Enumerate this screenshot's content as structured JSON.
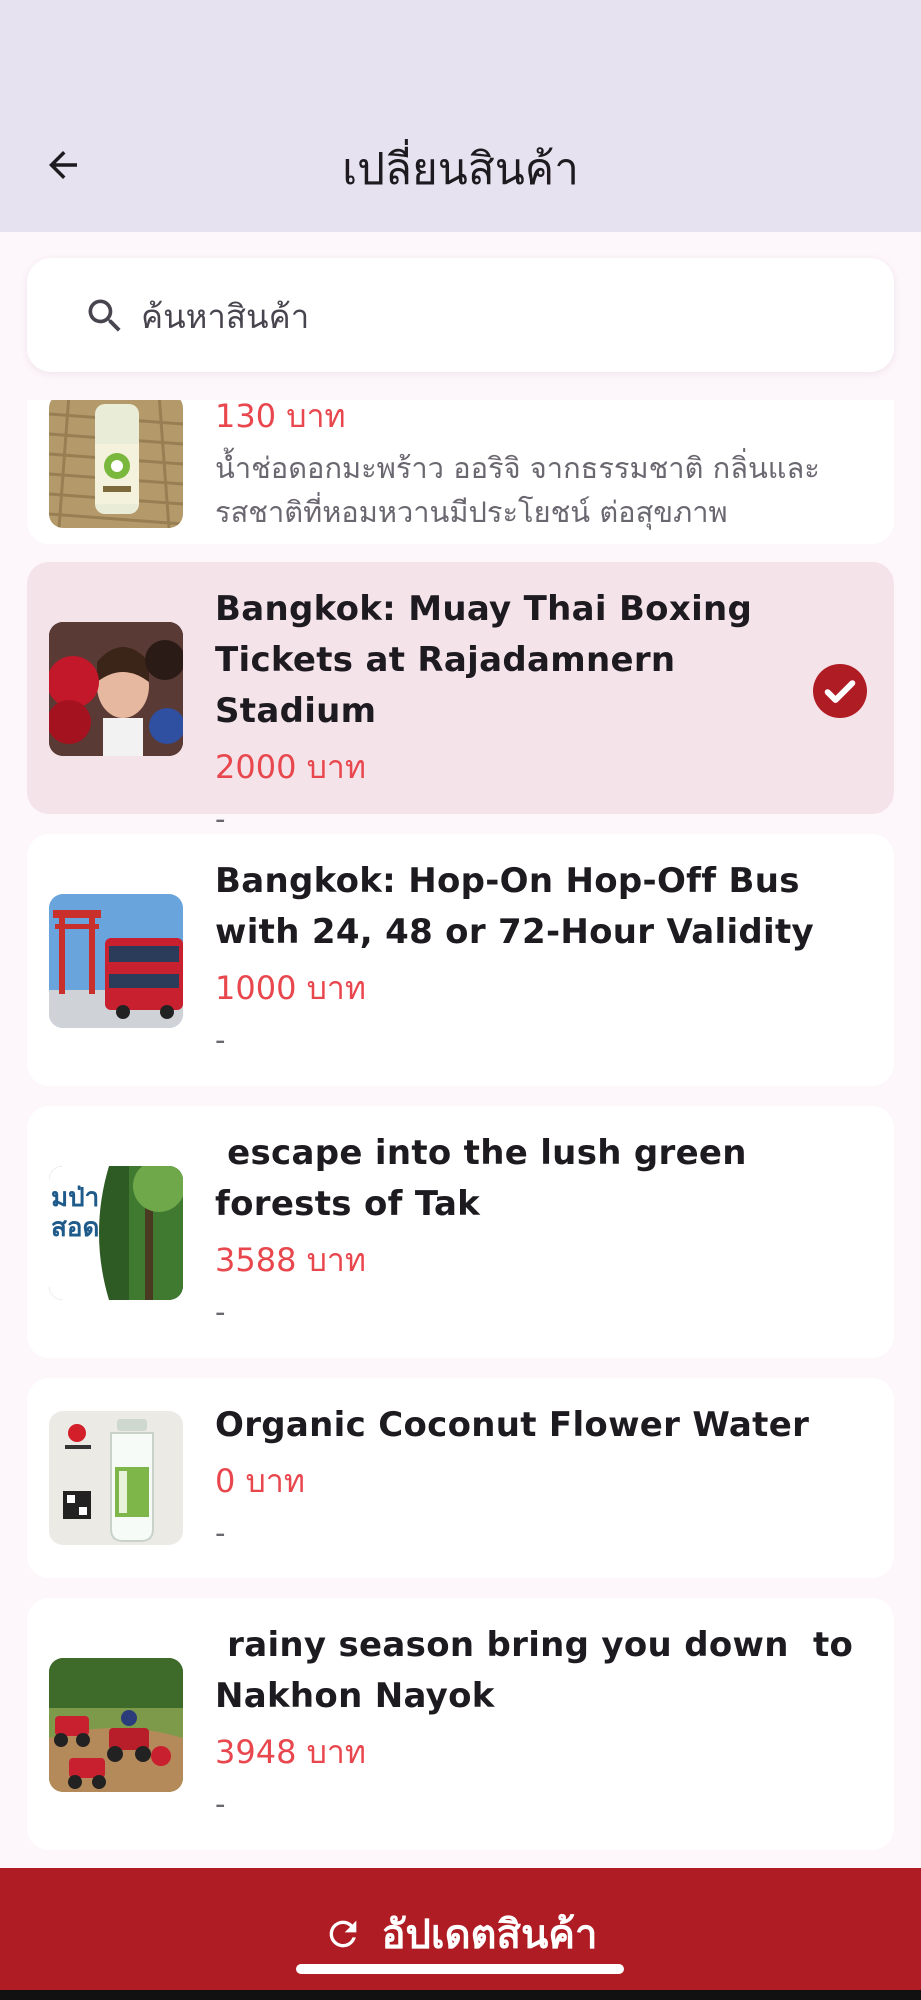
{
  "header": {
    "title": "เปลี่ยนสินค้า"
  },
  "search": {
    "placeholder": "ค้นหาสินค้า",
    "value": ""
  },
  "products": [
    {
      "title": "",
      "price": "130 บาท",
      "description": "น้ำช่อดอกมะพร้าว ออริจิ จากธรรมชาติ กลิ่นและรสชาติที่หอมหวานมีประโยชน์ ต่อสุขภาพ",
      "selected": false
    },
    {
      "title": "Bangkok: Muay Thai Boxing Tickets at Rajadamnern Stadium",
      "price": "2000 บาท",
      "description": "-",
      "selected": true
    },
    {
      "title": "Bangkok: Hop-On Hop-Off Bus with 24, 48 or 72-Hour Validity",
      "price": "1000 บาท",
      "description": "-",
      "selected": false
    },
    {
      "title": " escape into the lush green forests of Tak",
      "price": "3588 บาท",
      "description": "-",
      "selected": false,
      "thumb_text": "มป่า\nสอด"
    },
    {
      "title": "Organic Coconut Flower Water",
      "price": "0 บาท",
      "description": "-",
      "selected": false
    },
    {
      "title": " rainy season bring you down  to Nakhon Nayok",
      "price": "3948 บาท",
      "description": "-",
      "selected": false
    }
  ],
  "footer": {
    "update_label": "อัปเดตสินค้า"
  },
  "colors": {
    "header_bg": "#e7e2ef",
    "page_bg": "#fdf6fa",
    "selected_card_bg": "#f5e3ea",
    "price": "#e8474e",
    "accent": "#b01c24"
  },
  "icons": {
    "back": "arrow-left-icon",
    "search": "search-icon",
    "selected": "check-circle-icon",
    "update": "refresh-icon"
  }
}
